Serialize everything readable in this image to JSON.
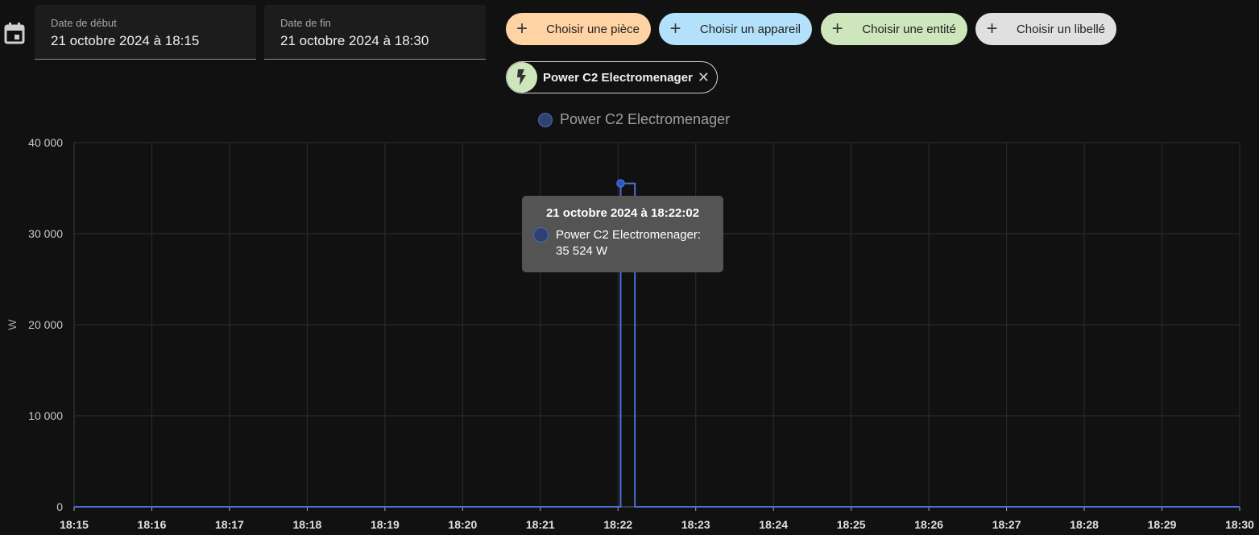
{
  "date_range": {
    "start_label": "Date de début",
    "start_value": "21 octobre 2024 à 18:15",
    "end_label": "Date de fin",
    "end_value": "21 octobre 2024 à 18:30"
  },
  "target_picker": {
    "chips": [
      {
        "label": "Choisir une pièce",
        "color": "#ffd3a3"
      },
      {
        "label": "Choisir un appareil",
        "color": "#b3e0fa"
      },
      {
        "label": "Choisir une entité",
        "color": "#cde6bb"
      },
      {
        "label": "Choisir un libellé",
        "color": "#e0e0e0"
      }
    ],
    "selected_entity": {
      "label": "Power C2 Electromenager",
      "icon": "lightning-bolt-icon",
      "remove_glyph": "✕"
    }
  },
  "colors": {
    "series_line": "#4b6fd6",
    "series_fill": "#2e4170",
    "background": "#111111",
    "grid": "#2e2e2e"
  },
  "tooltip": {
    "title": "21 octobre 2024 à 18:22:02",
    "series_line": "Power C2 Electromenager:",
    "value_line": "35 524 W"
  },
  "chart_data": {
    "type": "line",
    "step": true,
    "legend": [
      "Power C2 Electromenager"
    ],
    "legend_placement": "top-center",
    "ylabel": "W",
    "xlabel": "",
    "ylim": [
      0,
      40000
    ],
    "yticks": [
      "0",
      "10 000",
      "20 000",
      "30 000",
      "40 000"
    ],
    "xticks": [
      "18:15",
      "18:16",
      "18:17",
      "18:18",
      "18:19",
      "18:20",
      "18:21",
      "18:22",
      "18:23",
      "18:24",
      "18:25",
      "18:26",
      "18:27",
      "18:28",
      "18:29",
      "18:30"
    ],
    "grid": true,
    "series": [
      {
        "name": "Power C2 Electromenager",
        "unit": "W",
        "points": [
          {
            "t": "18:15:00",
            "y": 0
          },
          {
            "t": "18:22:02",
            "y": 0
          },
          {
            "t": "18:22:02",
            "y": 35524
          },
          {
            "t": "18:22:13",
            "y": 35524
          },
          {
            "t": "18:22:13",
            "y": 0
          },
          {
            "t": "18:30:00",
            "y": 0
          }
        ]
      }
    ]
  }
}
